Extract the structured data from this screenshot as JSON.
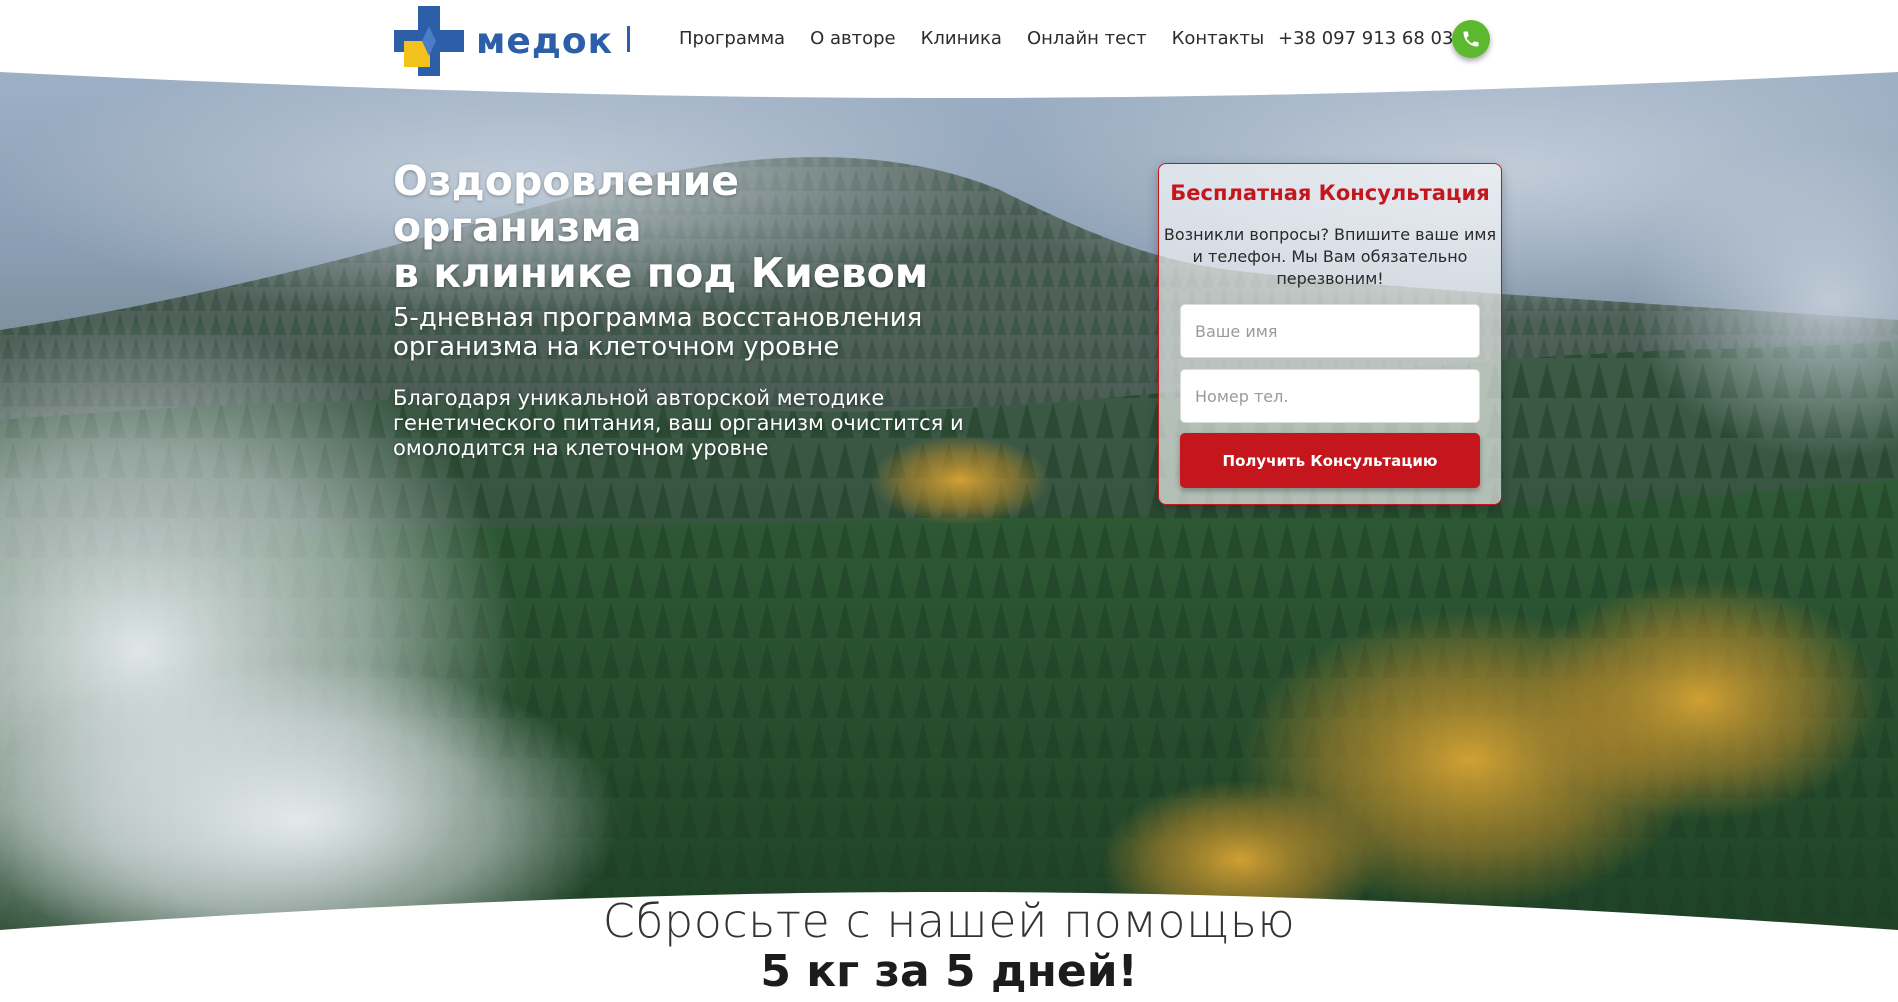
{
  "colors": {
    "brand_blue": "#2d5ea8",
    "brand_yellow": "#f4c21c",
    "accent_red": "#c4161c",
    "phone_green": "#5cb82e",
    "text_dark": "#2c2c2c"
  },
  "header": {
    "logo_text": "медок",
    "logo_icon": "cross-logo-icon",
    "nav": [
      {
        "label": "Программа"
      },
      {
        "label": "О авторе"
      },
      {
        "label": "Клиника"
      },
      {
        "label": "Онлайн тест"
      },
      {
        "label": "Контакты"
      }
    ],
    "phone": "+38 097 913 68 03",
    "phone_icon": "phone-icon"
  },
  "hero": {
    "title_line1": "Оздоровление организма",
    "title_line2": "в клинике под Киевом",
    "subtitle_line1": "5-дневная программа восстановления",
    "subtitle_line2": "организма на клеточном уровне",
    "desc_line1": "Благодаря уникальной авторской методике",
    "desc_line2": "генетического питания, ваш организм очистится и",
    "desc_line3": "омолодится на клеточном уровне"
  },
  "form": {
    "title": "Бесплатная Консультация",
    "desc_line1": "Возникли вопросы? Впишите ваше имя",
    "desc_line2": "и телефон. Мы Вам обязательно",
    "desc_line3": "перезвоним!",
    "name_placeholder": "Ваше имя",
    "phone_placeholder": "Номер тел.",
    "submit_label": "Получить Консультацию"
  },
  "promo": {
    "line1": "Сбросьте с нашей помощью",
    "line2": "5 кг за 5 дней!"
  }
}
